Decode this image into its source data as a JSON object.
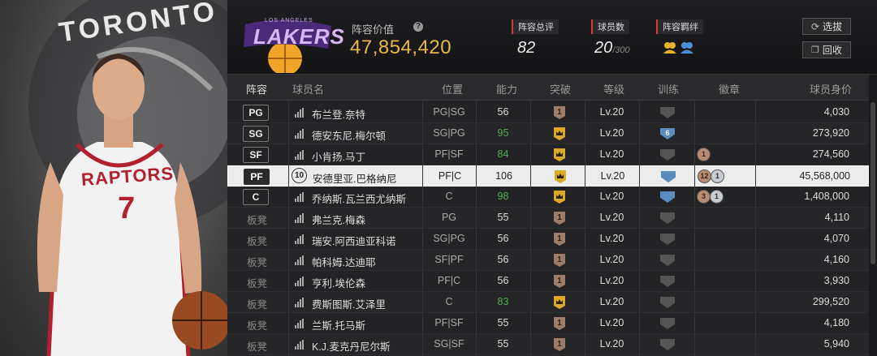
{
  "header": {
    "team_logo_text": "LAKERS",
    "team_logo_sub": "LOS ANGELES",
    "value_label": "阵容价值",
    "value_help": "?",
    "value": "47,854,420",
    "overall_label": "阵容总评",
    "overall": "82",
    "player_count_label": "球员数",
    "player_count": "20",
    "player_count_max": "/300",
    "synergy_label": "阵容羁绊",
    "btn_select": "选拔",
    "btn_recycle": "回收"
  },
  "art": {
    "team_text": "TORONTO",
    "jersey_text": "RAPTORS",
    "jersey_number": "7"
  },
  "columns": {
    "lineup": "阵容",
    "name": "球员名",
    "position": "位置",
    "rating": "能力",
    "breakthrough": "突破",
    "level": "等级",
    "training": "训练",
    "badges": "徽章",
    "price": "球员身价"
  },
  "rows": [
    {
      "slot": "PG",
      "name": "布兰登.奈特",
      "pos": "PG|SG",
      "rating": "56",
      "rating_color": "#dddddd",
      "brk": "1",
      "brk_type": "num",
      "level": "Lv.20",
      "train": "grey",
      "train_num": "",
      "badges": [],
      "price": "4,030"
    },
    {
      "slot": "SG",
      "name": "德安东尼.梅尔顿",
      "pos": "SG|PG",
      "rating": "95",
      "rating_color": "#4caf50",
      "brk": "",
      "brk_type": "crown",
      "level": "Lv.20",
      "train": "blue",
      "train_num": "6",
      "badges": [],
      "price": "273,920"
    },
    {
      "slot": "SF",
      "name": "小肯扬.马丁",
      "pos": "PF|SF",
      "rating": "84",
      "rating_color": "#4caf50",
      "brk": "",
      "brk_type": "crown",
      "level": "Lv.20",
      "train": "grey",
      "train_num": "",
      "badges": [
        {
          "t": "bz",
          "v": "1"
        }
      ],
      "price": "274,560"
    },
    {
      "slot": "PF",
      "name": "安德里亚.巴格纳尼",
      "pos": "PF|C",
      "rating": "106",
      "rating_color": "#222222",
      "brk": "",
      "brk_type": "crown",
      "level": "Lv.20",
      "train": "blue",
      "train_num": "",
      "badges": [
        {
          "t": "bz",
          "v": "12"
        },
        {
          "t": "sv",
          "v": "1"
        }
      ],
      "price": "45,568,000",
      "selected": true,
      "number": "10"
    },
    {
      "slot": "C",
      "name": "乔纳斯.瓦兰西尤纳斯",
      "pos": "C",
      "rating": "98",
      "rating_color": "#4caf50",
      "brk": "",
      "brk_type": "crown",
      "level": "Lv.20",
      "train": "blue",
      "train_num": "",
      "badges": [
        {
          "t": "bz",
          "v": "3"
        },
        {
          "t": "sv",
          "v": "1"
        }
      ],
      "price": "1,408,000"
    },
    {
      "slot": "板凳",
      "name": "弗兰克.梅森",
      "pos": "PG",
      "rating": "55",
      "rating_color": "#dddddd",
      "brk": "1",
      "brk_type": "num",
      "level": "Lv.20",
      "train": "grey",
      "train_num": "",
      "badges": [],
      "price": "4,110"
    },
    {
      "slot": "板凳",
      "name": "瑞安.阿西迪亚科诺",
      "pos": "SG|PG",
      "rating": "56",
      "rating_color": "#dddddd",
      "brk": "1",
      "brk_type": "num",
      "level": "Lv.20",
      "train": "grey",
      "train_num": "",
      "badges": [],
      "price": "4,070"
    },
    {
      "slot": "板凳",
      "name": "帕科姆.达迪耶",
      "pos": "SF|PF",
      "rating": "56",
      "rating_color": "#dddddd",
      "brk": "1",
      "brk_type": "num",
      "level": "Lv.20",
      "train": "grey",
      "train_num": "",
      "badges": [],
      "price": "4,160"
    },
    {
      "slot": "板凳",
      "name": "亨利.埃伦森",
      "pos": "PF|C",
      "rating": "56",
      "rating_color": "#dddddd",
      "brk": "1",
      "brk_type": "num",
      "level": "Lv.20",
      "train": "grey",
      "train_num": "",
      "badges": [],
      "price": "3,930"
    },
    {
      "slot": "板凳",
      "name": "费斯图斯.艾泽里",
      "pos": "C",
      "rating": "83",
      "rating_color": "#4caf50",
      "brk": "",
      "brk_type": "crown",
      "level": "Lv.20",
      "train": "grey",
      "train_num": "",
      "badges": [],
      "price": "299,520"
    },
    {
      "slot": "板凳",
      "name": "兰斯.托马斯",
      "pos": "PF|SF",
      "rating": "55",
      "rating_color": "#dddddd",
      "brk": "1",
      "brk_type": "num",
      "level": "Lv.20",
      "train": "grey",
      "train_num": "",
      "badges": [],
      "price": "4,180"
    },
    {
      "slot": "板凳",
      "name": "K.J.麦克丹尼尔斯",
      "pos": "SG|SF",
      "rating": "55",
      "rating_color": "#dddddd",
      "brk": "1",
      "brk_type": "num",
      "level": "Lv.20",
      "train": "grey",
      "train_num": "",
      "badges": [],
      "price": "5,940"
    }
  ]
}
